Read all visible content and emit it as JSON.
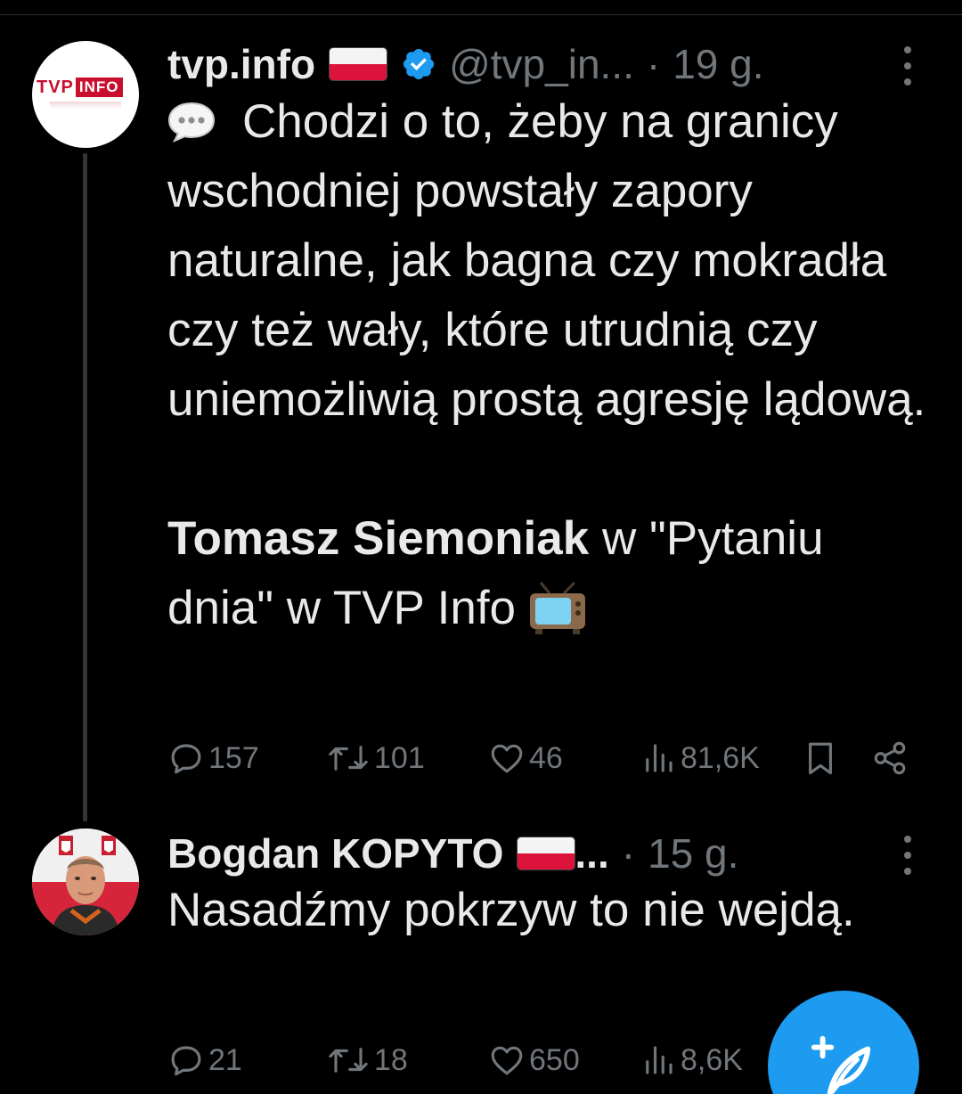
{
  "tweets": [
    {
      "display_name": "tvp.info",
      "handle": "@tvp_in...",
      "separator": "·",
      "time": "19 g.",
      "avatar_text_left": "TVP",
      "avatar_text_right": "INFO",
      "text_line": "Chodzi o to, żeby na granicy wschodniej powstały zapory naturalne, jak bagna czy mokradła czy też wały, które utrudnią czy uniemożliwią prostą agresję lądową.",
      "credit_name": "Tomasz Siemoniak",
      "credit_rest": " w \"Pytaniu dnia\" w TVP Info",
      "stats": {
        "replies": "157",
        "retweets": "101",
        "likes": "46",
        "views": "81,6K"
      }
    },
    {
      "display_name": "Bogdan KOPYTO",
      "name_ellipsis": "...",
      "separator": "·",
      "time": "15 g.",
      "text_line": "Nasadźmy pokrzyw to nie wejdą.",
      "stats": {
        "replies": "21",
        "retweets": "18",
        "likes": "650",
        "views": "8,6K"
      }
    }
  ],
  "colors": {
    "background": "#000000",
    "text": "#e7e9ea",
    "muted": "#71767b",
    "accent": "#1d9bf0",
    "thread_line": "#333639"
  },
  "icons": [
    "speech-balloon-emoji",
    "tv-emoji",
    "verified-icon",
    "poland-flag-icon",
    "reply-icon",
    "retweet-icon",
    "like-icon",
    "views-icon",
    "bookmark-icon",
    "share-icon",
    "more-icon",
    "compose-icon"
  ]
}
